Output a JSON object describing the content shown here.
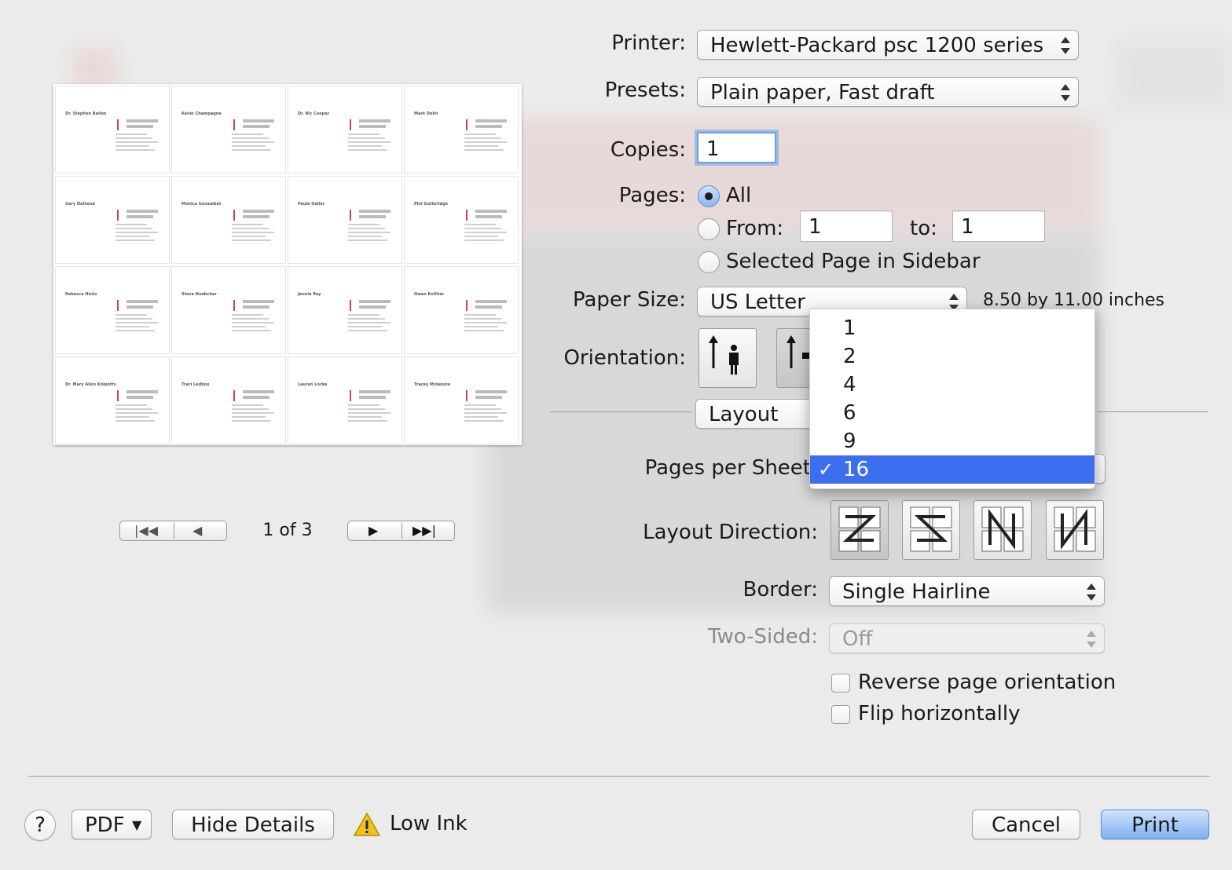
{
  "printer": {
    "label": "Printer:",
    "value": "Hewlett-Packard psc 1200 series"
  },
  "presets": {
    "label": "Presets:",
    "value": "Plain paper, Fast draft"
  },
  "copies": {
    "label": "Copies:",
    "value": "1"
  },
  "pages": {
    "label": "Pages:",
    "all_label": "All",
    "from_label": "From:",
    "from_value": "1",
    "to_label": "to:",
    "to_value": "1",
    "selected_label": "Selected Page in Sidebar"
  },
  "paper_size": {
    "label": "Paper Size:",
    "value": "US Letter",
    "dimensions": "8.50 by 11.00 inches"
  },
  "orientation": {
    "label": "Orientation:"
  },
  "section_popup": {
    "value": "Layout"
  },
  "pages_per_sheet": {
    "label": "Pages per Sheet",
    "options": [
      "1",
      "2",
      "4",
      "6",
      "9",
      "16"
    ],
    "selected": "16",
    "check": "✓"
  },
  "layout_direction": {
    "label": "Layout Direction:"
  },
  "border": {
    "label": "Border:",
    "value": "Single Hairline"
  },
  "two_sided": {
    "label": "Two-Sided:",
    "value": "Off"
  },
  "reverse_label": "Reverse page orientation",
  "flip_label": "Flip horizontally",
  "preview_nav": {
    "page_status": "1 of 3"
  },
  "preview_cards": [
    "Dr. Stephen Bailon",
    "Kevin Champagne",
    "Dr. Nic Cooper",
    "Mark Dolin",
    "Gary Dattend",
    "Monica Gonzalbet",
    "Paula Geller",
    "Phil Gutteridge",
    "Rebecca Hicks",
    "Steve Nuebcher",
    "Jennie Ray",
    "Owen Kolliter",
    "Dr. Mary Alice Knipotts",
    "Traci Ledbox",
    "Lauren Locke",
    "Tracey Mckenzie"
  ],
  "bottom": {
    "help": "?",
    "pdf": "PDF",
    "hide_details": "Hide Details",
    "warning": "Low Ink",
    "cancel": "Cancel",
    "print": "Print"
  },
  "icons": {
    "warning": "warning-triangle-icon",
    "pdf_arrow": "chevron-down-icon"
  },
  "colors": {
    "menu_highlight": "#3c6ff0",
    "default_button": "#7fb0ef",
    "warning": "#f2c21a"
  }
}
